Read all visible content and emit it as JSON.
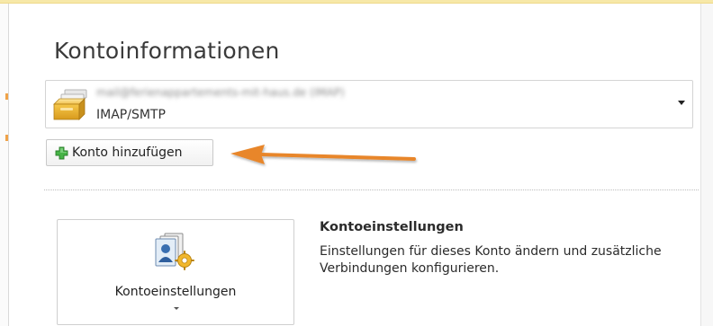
{
  "page": {
    "title": "Kontoinformationen"
  },
  "account": {
    "email": "mail@ferienappartements-mit-haus.de (IMAP)",
    "type": "IMAP/SMTP",
    "icon": "mailbox-stack-icon"
  },
  "add_account": {
    "label": "Konto hinzufügen",
    "icon": "green-plus-icon"
  },
  "annotation": {
    "color": "#e8862a"
  },
  "account_settings": {
    "button_label": "Kontoeinstellungen",
    "heading": "Kontoeinstellungen",
    "description": "Einstellungen für dieses Konto ändern und zusätzliche Verbindungen konfigurieren."
  },
  "colors": {
    "accent_top": "#f7e8a8",
    "plus_green": "#3aa63a",
    "arrow_orange": "#e8862a"
  }
}
